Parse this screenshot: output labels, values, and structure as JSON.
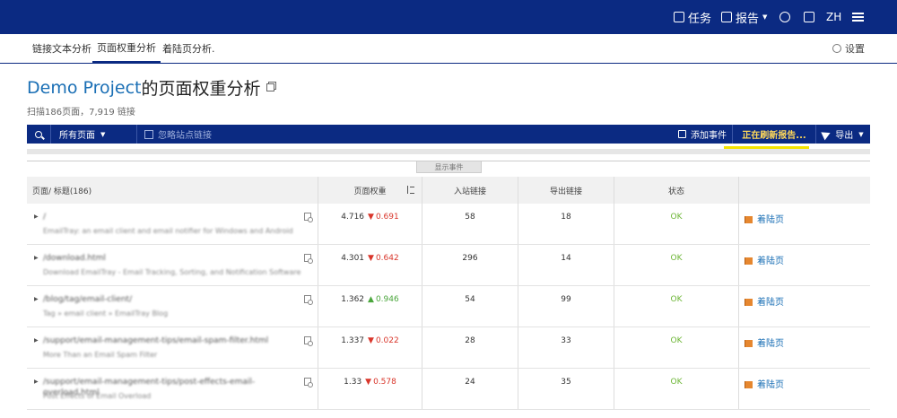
{
  "topbar": {
    "tasks": "任务",
    "report": "报告",
    "lang": "ZH"
  },
  "subnav": {
    "tabs": [
      "链接文本分析",
      "页面权重分析",
      "着陆页分析."
    ],
    "active_index": 1,
    "settings": "设置"
  },
  "header": {
    "project": "Demo Project",
    "title_suffix": " 的页面权重分析",
    "subtitle": "扫描186页面，7,919 链接"
  },
  "toolbar": {
    "pages_filter": "所有页面",
    "ignore_label": "忽略站点链接",
    "add_event": "添加事件",
    "refreshing": "正在刷新报告...",
    "export": "导出"
  },
  "events": {
    "show_label": "显示事件"
  },
  "table": {
    "headers": [
      "页面/ 标题(186)",
      "页面权重",
      "入站链接",
      "导出链接",
      "状态",
      ""
    ],
    "rows": [
      {
        "url": "/",
        "desc": "EmailTray: an email client and email notifier for Windows and Android",
        "weight": "4.716",
        "change": "0.691",
        "dir": "down",
        "in": "58",
        "out": "18",
        "status": "OK",
        "action": "着陆页"
      },
      {
        "url": "/download.html",
        "desc": "Download EmailTray - Email Tracking, Sorting, and Notification Software",
        "weight": "4.301",
        "change": "0.642",
        "dir": "down",
        "in": "296",
        "out": "14",
        "status": "OK",
        "action": "着陆页"
      },
      {
        "url": "/blog/tag/email-client/",
        "desc": "Tag » email client » EmailTray Blog",
        "weight": "1.362",
        "change": "0.946",
        "dir": "up",
        "in": "54",
        "out": "99",
        "status": "OK",
        "action": "着陆页"
      },
      {
        "url": "/support/email-management-tips/email-spam-filter.html",
        "desc": "More Than an Email Spam Filter",
        "weight": "1.337",
        "change": "0.022",
        "dir": "down",
        "in": "28",
        "out": "33",
        "status": "OK",
        "action": "着陆页"
      },
      {
        "url": "/support/email-management-tips/post-effects-email-overload.html",
        "desc": "Post Effects of Email Overload",
        "weight": "1.33",
        "change": "0.578",
        "dir": "down",
        "in": "24",
        "out": "35",
        "status": "OK",
        "action": "着陆页"
      }
    ]
  },
  "colors": {
    "brand": "#0b2a82",
    "link": "#1a6fb5",
    "down": "#d9362b",
    "up": "#4aa63c",
    "ok": "#6bb534",
    "refresh": "#ffd95a"
  }
}
